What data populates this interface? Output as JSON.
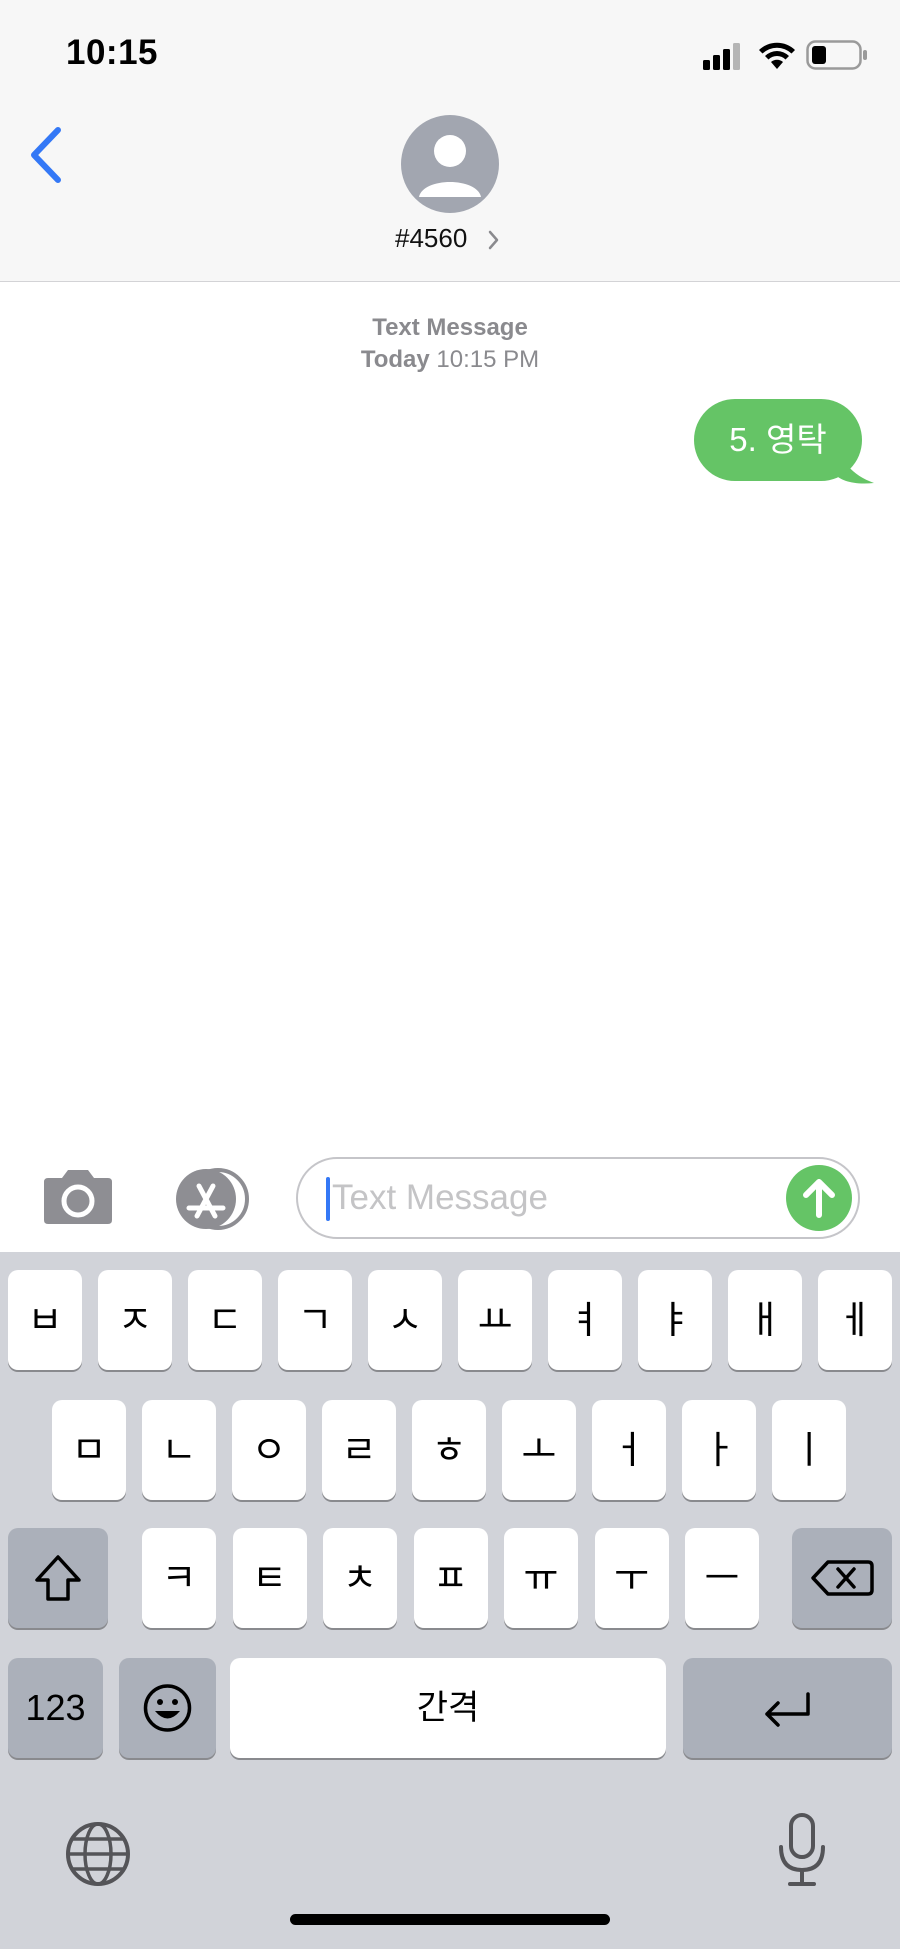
{
  "status_bar": {
    "time": "10:15"
  },
  "header": {
    "contact_name": "#4560"
  },
  "conversation": {
    "service_label": "Text Message",
    "day_label": "Today",
    "time_label": "10:15 PM",
    "messages": [
      {
        "text": "5. 영탁",
        "direction": "outgoing"
      }
    ]
  },
  "composer": {
    "placeholder": "Text Message"
  },
  "keyboard": {
    "row1": [
      "ㅂ",
      "ㅈ",
      "ㄷ",
      "ㄱ",
      "ㅅ",
      "ㅛ",
      "ㅕ",
      "ㅑ",
      "ㅐ",
      "ㅔ"
    ],
    "row2": [
      "ㅁ",
      "ㄴ",
      "ㅇ",
      "ㄹ",
      "ㅎ",
      "ㅗ",
      "ㅓ",
      "ㅏ",
      "ㅣ"
    ],
    "row3": [
      "ㅋ",
      "ㅌ",
      "ㅊ",
      "ㅍ",
      "ㅠ",
      "ㅜ",
      "ㅡ"
    ],
    "numbers_label": "123",
    "space_label": "간격"
  },
  "colors": {
    "accent": "#3478f6",
    "bubble": "#65c466",
    "keyboard_bg": "#d1d3d9"
  }
}
